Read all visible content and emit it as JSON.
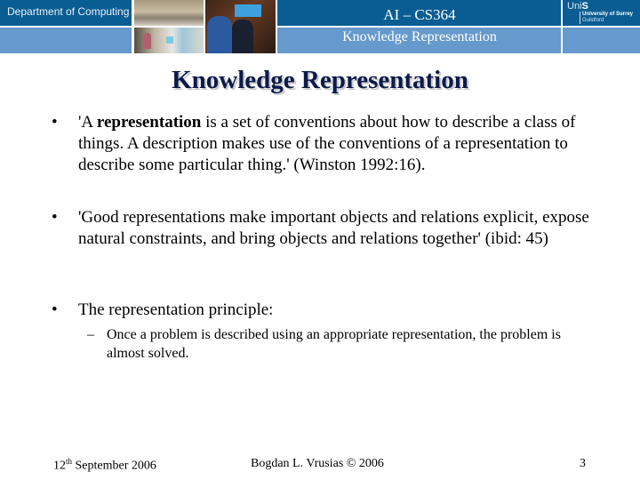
{
  "header": {
    "department": "Department of Computing",
    "course": "AI – CS364",
    "subtitle": "Knowledge Representation",
    "logo": {
      "uni_prefix": "Uni",
      "uni_suffix": "S",
      "line1": "University of Surrey",
      "line2": "Guildford"
    },
    "colors": {
      "dark_band": "#0a5d92",
      "light_band": "#6699cc"
    }
  },
  "slide": {
    "title": "Knowledge Representation",
    "bullets": [
      {
        "prefix": "'A ",
        "bold": "representation",
        "text": " is a set of conventions about how to describe a class of things.  A description makes use of the conventions of a representation to describe some particular thing.' (Winston 1992:16)."
      },
      {
        "text": "'Good representations make important objects and relations explicit, expose natural constraints, and bring objects and relations together' (ibid: 45)"
      },
      {
        "text": "The representation principle:",
        "sub": [
          {
            "text": "Once a problem is described using an appropriate representation, the problem is almost solved."
          }
        ]
      }
    ],
    "bullet_glyph": "•",
    "sub_glyph": "–"
  },
  "footer": {
    "date_day": "12",
    "date_suffix": "th",
    "date_rest": " September 2006",
    "author": "Bogdan L. Vrusias © 2006",
    "page": "3"
  }
}
